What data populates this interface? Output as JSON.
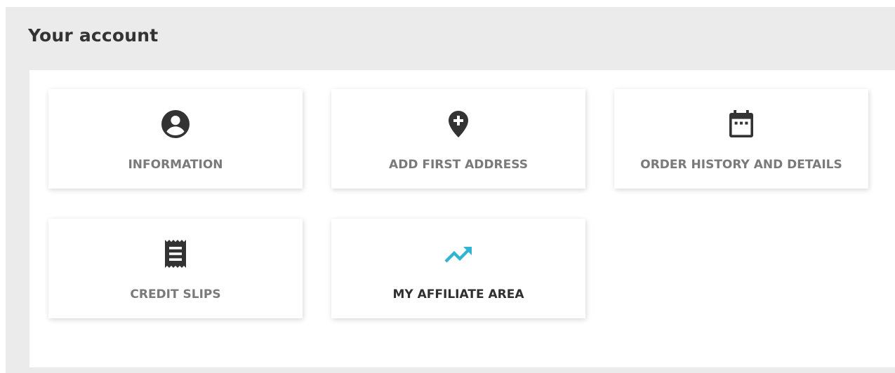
{
  "page": {
    "title": "Your account"
  },
  "tiles": [
    {
      "label": "INFORMATION",
      "icon": "account-circle-icon"
    },
    {
      "label": "ADD FIRST ADDRESS",
      "icon": "add-location-icon"
    },
    {
      "label": "ORDER HISTORY AND DETAILS",
      "icon": "calendar-icon"
    },
    {
      "label": "CREDIT SLIPS",
      "icon": "receipt-icon"
    },
    {
      "label": "MY AFFILIATE AREA",
      "icon": "trending-up-icon"
    }
  ],
  "colors": {
    "background": "#ebebeb",
    "icon_dark": "#333333",
    "label_grey": "#7a7a7a",
    "label_active": "#2f2f2f",
    "accent_teal": "#2fb5d2"
  }
}
